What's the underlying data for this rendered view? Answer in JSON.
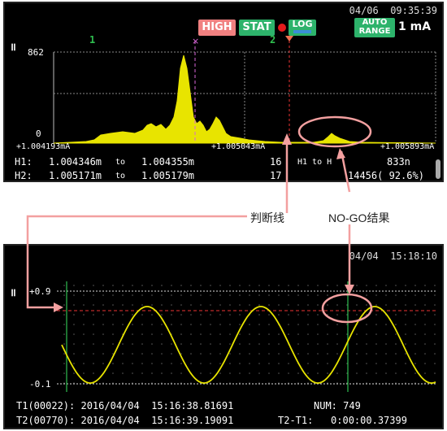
{
  "top_screen": {
    "datetime": "04/06  09:35:39",
    "high_label": "HIGH",
    "stat_label": "STAT",
    "log_label": "LOG",
    "auto_range_label": "AUTO\nRANGE",
    "range_value": "1 mA",
    "cursor1_label": "1",
    "cursor2_label": "2",
    "pause_icon": "pause-icon",
    "y_max": "862",
    "y_min": "0",
    "x_left": "+1.004193mA",
    "x_mid": "+1.005043mA",
    "x_right": "+1.005893mA",
    "h1_label": "H1:",
    "h1_from": "1.004346m",
    "h1_to_word": "to",
    "h1_to": "1.004355m",
    "h1_count": "16",
    "h1_to_h2": "H1 to H",
    "h1_to_h2_value": "833n",
    "h2_label": "H2:",
    "h2_from": "1.005171m",
    "h2_to_word": "to",
    "h2_to": "1.005179m",
    "h2_count": "17",
    "h2_total": "14456( 92.6%)",
    "colors": {
      "high": "#f08080",
      "stat": "#2db36b",
      "accent": "#f5a3a3",
      "trace": "#e8e400",
      "cursor": "#2fbf4f"
    }
  },
  "annotations": {
    "judge_line": "判断线",
    "nogo_result": "NO-GO结果"
  },
  "bottom_screen": {
    "datetime": "04/04  15:18:10",
    "pause_icon": "pause-icon",
    "y_top": "+0.9",
    "y_bottom": "-0.1",
    "t1_line": "T1(00022): 2016/04/04  15:16:38.81691",
    "num_line": "NUM: 749",
    "t2_line": "T2(00770): 2016/04/04  15:16:39.19091",
    "diff_line": "T2-T1:   0:00:00.37399"
  }
}
